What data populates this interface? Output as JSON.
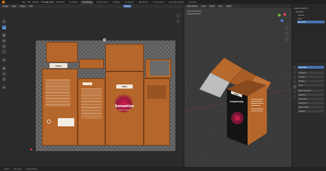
{
  "topbar": {
    "menu": [
      "File",
      "Edit",
      "Render",
      "Window",
      "Help"
    ],
    "tabs": [
      "Layout",
      "Modeling",
      "Sculpting",
      "UV Editing",
      "Texture Paint",
      "Shading",
      "Animation",
      "Rendering",
      "Compositing",
      "Geometry Nodes",
      "Scripting"
    ],
    "active_tab": "UV Editing"
  },
  "uv_editor": {
    "header": [
      "Image",
      "View",
      "Image",
      "UVs"
    ],
    "image_name": "Cream",
    "tools": [
      "cursor",
      "select-box",
      "move",
      "rotate",
      "scale",
      "transform",
      "annotate",
      "grab",
      "relax",
      "pinch",
      "rip"
    ]
  },
  "dieline": {
    "brand_logo": "sefex",
    "product_name": "Sensation",
    "product_sub": "Pleasure Ring"
  },
  "viewport": {
    "header": [
      "Object Mode",
      "View",
      "Select",
      "Add",
      "Object"
    ],
    "info_line1": "User Perspective",
    "info_line2": "(124) Plane.002"
  },
  "outliner": {
    "items": [
      "Scene Collection",
      "Collection",
      "Camera",
      "Light",
      "Plane.002"
    ]
  },
  "properties": {
    "rows": [
      "Plane.002",
      "Transform",
      "Location",
      "Rotation",
      "Scale",
      "Delta Transform",
      "Relations",
      "Collections",
      "Instancing",
      "Motion Paths",
      "Visibility"
    ]
  },
  "status": {
    "items": [
      "Select",
      "Pan View",
      "Context Menu"
    ]
  },
  "colors": {
    "box_orange": "#b5662a",
    "box_black": "#141414",
    "accent_blue": "#4772b3"
  }
}
